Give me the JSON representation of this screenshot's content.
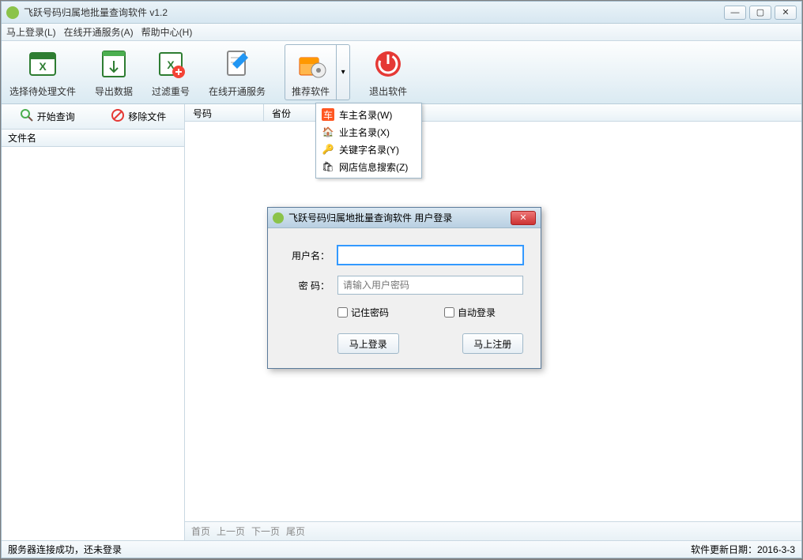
{
  "title": "飞跃号码归属地批量查询软件 v1.2",
  "menu": {
    "login": "马上登录(L)",
    "online": "在线开通服务(A)",
    "help": "帮助中心(H)"
  },
  "toolbar": {
    "select_file": "选择待处理文件",
    "export": "导出数据",
    "filter_dup": "过滤重号",
    "online_service": "在线开通服务",
    "recommend": "推荐软件",
    "exit": "退出软件"
  },
  "side": {
    "start": "开始查询",
    "remove": "移除文件",
    "file_header": "文件名"
  },
  "cols": {
    "number": "号码",
    "province": "省份"
  },
  "pager": {
    "first": "首页",
    "prev": "上一页",
    "next": "下一页",
    "last": "尾页"
  },
  "dropdown": {
    "car": "车主名录(W)",
    "owner": "业主名录(X)",
    "keyword": "关键字名录(Y)",
    "shop": "网店信息搜索(Z)"
  },
  "dialog": {
    "title": "飞跃号码归属地批量查询软件 用户登录",
    "username": "用户名：",
    "password": "密  码：",
    "pw_placeholder": "请输入用户密码",
    "remember": "记住密码",
    "auto": "自动登录",
    "login_btn": "马上登录",
    "register_btn": "马上注册"
  },
  "status": {
    "left": "服务器连接成功，还未登录",
    "right": "软件更新日期：2016-3-3"
  }
}
